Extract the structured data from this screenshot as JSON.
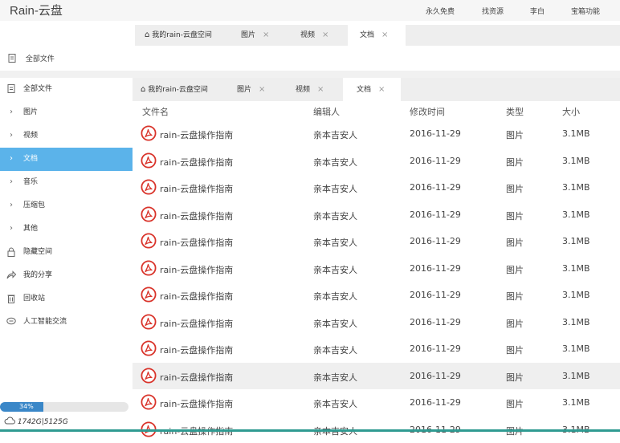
{
  "app": {
    "title": "Rain-云盘"
  },
  "topnav": [
    "永久免费",
    "找资源",
    "李白",
    "宝箱功能"
  ],
  "strip": {
    "all_files": "全部文件",
    "tabs": [
      {
        "label": "我的rain-云盘空间",
        "icon": "home-icon"
      },
      {
        "label": "图片",
        "close": "×"
      },
      {
        "label": "视频",
        "close": "×"
      },
      {
        "label": "文档",
        "close": "×",
        "active": true
      }
    ]
  },
  "sidebar": {
    "items": [
      {
        "label": "全部文件",
        "icon": "file-icon"
      },
      {
        "label": "图片",
        "icon": "chevron-right-icon"
      },
      {
        "label": "视频",
        "icon": "chevron-right-icon"
      },
      {
        "label": "文档",
        "icon": "chevron-right-icon",
        "active": true
      },
      {
        "label": "音乐",
        "icon": "chevron-right-icon"
      },
      {
        "label": "压缩包",
        "icon": "chevron-right-icon"
      },
      {
        "label": "其他",
        "icon": "chevron-right-icon"
      },
      {
        "label": "隐藏空间",
        "icon": "lock-icon"
      },
      {
        "label": "我的分享",
        "icon": "share-icon"
      },
      {
        "label": "回收站",
        "icon": "trash-icon"
      },
      {
        "label": "人工智能交流",
        "icon": "chat-icon"
      }
    ],
    "progress": {
      "label": "34%",
      "value": 0.34
    },
    "storage": "1742G|5125G"
  },
  "main": {
    "tabs": [
      {
        "label": "我的rain-云盘空间",
        "icon": "home-icon"
      },
      {
        "label": "图片",
        "close": "×"
      },
      {
        "label": "视频",
        "close": "×"
      },
      {
        "label": "文档",
        "close": "×",
        "active": true
      }
    ],
    "columns": [
      "文件名",
      "编辑人",
      "修改时间",
      "类型",
      "大小"
    ],
    "rows": [
      {
        "name": "rain-云盘操作指南",
        "editor": "亲本吉安人",
        "date": "2016-11-29",
        "type": "图片",
        "size": "3.1MB"
      },
      {
        "name": "rain-云盘操作指南",
        "editor": "亲本吉安人",
        "date": "2016-11-29",
        "type": "图片",
        "size": "3.1MB"
      },
      {
        "name": "rain-云盘操作指南",
        "editor": "亲本吉安人",
        "date": "2016-11-29",
        "type": "图片",
        "size": "3.1MB"
      },
      {
        "name": "rain-云盘操作指南",
        "editor": "亲本吉安人",
        "date": "2016-11-29",
        "type": "图片",
        "size": "3.1MB"
      },
      {
        "name": "rain-云盘操作指南",
        "editor": "亲本吉安人",
        "date": "2016-11-29",
        "type": "图片",
        "size": "3.1MB"
      },
      {
        "name": "rain-云盘操作指南",
        "editor": "亲本吉安人",
        "date": "2016-11-29",
        "type": "图片",
        "size": "3.1MB"
      },
      {
        "name": "rain-云盘操作指南",
        "editor": "亲本吉安人",
        "date": "2016-11-29",
        "type": "图片",
        "size": "3.1MB"
      },
      {
        "name": "rain-云盘操作指南",
        "editor": "亲本吉安人",
        "date": "2016-11-29",
        "type": "图片",
        "size": "3.1MB"
      },
      {
        "name": "rain-云盘操作指南",
        "editor": "亲本吉安人",
        "date": "2016-11-29",
        "type": "图片",
        "size": "3.1MB"
      },
      {
        "name": "rain-云盘操作指南",
        "editor": "亲本吉安人",
        "date": "2016-11-29",
        "type": "图片",
        "size": "3.1MB",
        "highlighted": true
      },
      {
        "name": "rain-云盘操作指南",
        "editor": "亲本吉安人",
        "date": "2016-11-29",
        "type": "图片",
        "size": "3.1MB"
      },
      {
        "name": "rain-云盘操作指南",
        "editor": "亲本吉安人",
        "date": "2016-11-29",
        "type": "图片",
        "size": "3.1MB"
      }
    ]
  },
  "colors": {
    "accent": "#5bb3ea",
    "progress": "#3a87c8",
    "pdf_icon": "#d9342b",
    "bottom_bar": "#2f9a91"
  }
}
